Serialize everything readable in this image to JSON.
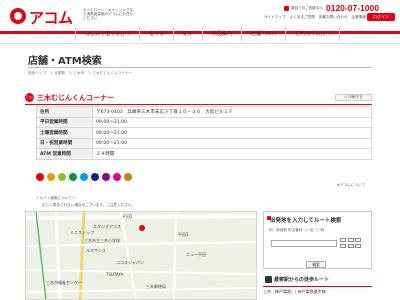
{
  "header": {
    "logo_text": "アコム",
    "tagline": "カードローン・キャッシングなら消費者金融のアコムにお任せください",
    "phone_label": "電話でのご相談なら",
    "phone_number": "0120-07-1000",
    "util_links": [
      "サイトマップ",
      "よくあるご質問",
      "各種お問い合わせ",
      "企業情報サイト"
    ],
    "login_label": "ログイン"
  },
  "nav": [
    "はじめて借りる方へ",
    "借りる",
    "返す",
    "商品案内",
    "店舗・ATM",
    "ご利用中の方へ"
  ],
  "page": {
    "title": "店舗・ATM検索",
    "breadcrumb": "検索トップ　＞ 兵庫県　＞ 三木市　＞ 三木むじんくんコーナー"
  },
  "store": {
    "icon_text": "アコム",
    "name": "三木むじんくんコーナー",
    "print_label": "印刷する",
    "rows": [
      {
        "label": "住所",
        "value": "〒673-0403　兵庫県三木市末広３丁目１０－２６　大館ビル１Ｆ"
      },
      {
        "label": "平日営業時間",
        "value": "09:00～21:00"
      },
      {
        "label": "土曜営業時間",
        "value": "09:00～21:00"
      },
      {
        "label": "日・祝営業時間",
        "value": "09:00～21:00"
      },
      {
        "label": "ATM 営業時間",
        "value": "２４時間"
      }
    ],
    "service_icon_colors": [
      "#e60012",
      "#f39800",
      "#8fc31f",
      "#009944",
      "#00a0e9",
      "#1d2088",
      "#920783",
      "#e4007f",
      "#b8860b"
    ],
    "acom_note": "※アコムについて"
  },
  "route_notes": {
    "line1": "＜ルート検索について＞",
    "line2": "正しく表示されない場合がございます。ご注意ください。"
  },
  "map": {
    "labels": [
      "平田1",
      "平田1",
      "スタジオアリス",
      "ミニストップ",
      "三木市立三木小学校",
      "ルネサンス",
      "ココスジャパン",
      "TSUTAYA",
      "ニュー平田",
      "三木市福祉センター",
      "三木郵便局"
    ]
  },
  "route_panel": {
    "title": "出発地を入力してルート検索",
    "hint": "例：新宿駅 町名番地 ○○区 ○○町",
    "search_label": "検索"
  },
  "station": {
    "title": "最寄駅からの徒歩ルート",
    "row": "三木（神戸電鉄）/ 神戸電鉄粟生線"
  }
}
